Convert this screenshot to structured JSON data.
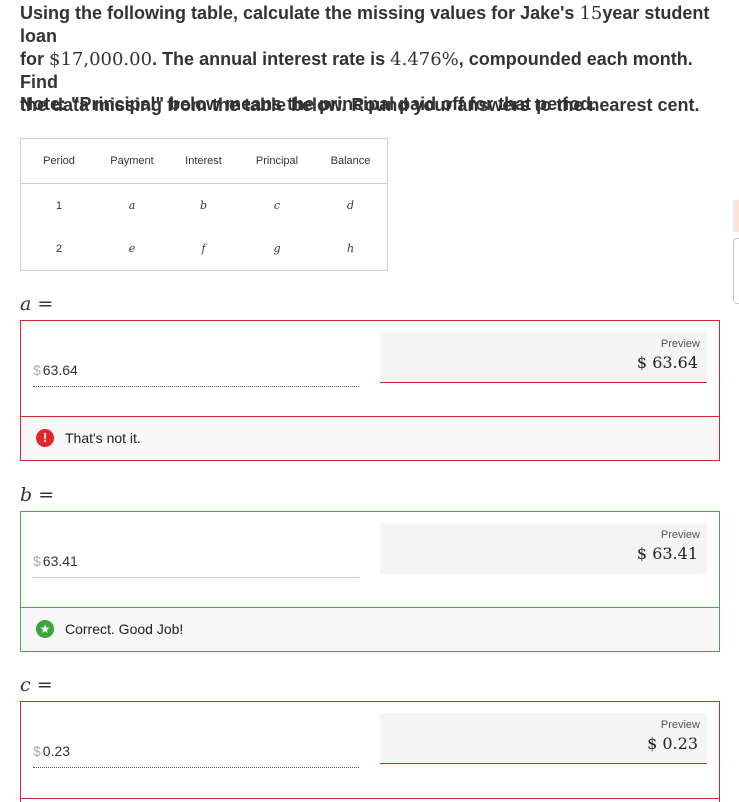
{
  "question": {
    "line1_prefix": "Using the following table, calculate the missing values for Jake's ",
    "line1_years": "15",
    "line1_suffix": "year student loan",
    "line2_prefix": "for ",
    "line2_amount": "$17,000.00",
    "line2_mid": ". The annual interest rate is ",
    "line2_rate": "4.476%",
    "line2_suffix": ", compounded each month. Find",
    "line3": "the data missing from the table below. Round your answers to the nearest cent.",
    "note": "Note: \"Principal\" below means the principal paid off for that period."
  },
  "table": {
    "headers": [
      "Period",
      "Payment",
      "Interest",
      "Principal",
      "Balance"
    ],
    "rows": [
      [
        "1",
        "a",
        "b",
        "c",
        "d"
      ],
      [
        "2",
        "e",
        "f",
        "g",
        "h"
      ]
    ]
  },
  "answers": {
    "a": {
      "label": "a",
      "eq": "=",
      "currency": "$",
      "value": "63.64",
      "preview_label": "Preview",
      "preview_value": "$ 63.64",
      "icon": "!",
      "feedback": "That's not it."
    },
    "b": {
      "label": "b",
      "eq": "=",
      "currency": "$",
      "value": "63.41",
      "preview_label": "Preview",
      "preview_value": "$ 63.41",
      "icon": "★",
      "feedback": "Correct. Good Job!"
    },
    "c": {
      "label": "c",
      "eq": "=",
      "currency": "$",
      "value": "0.23",
      "preview_label": "Preview",
      "preview_value": "$ 0.23"
    }
  },
  "colors": {
    "wrong": "#cc2b2b",
    "correct": "#4aa84a"
  }
}
